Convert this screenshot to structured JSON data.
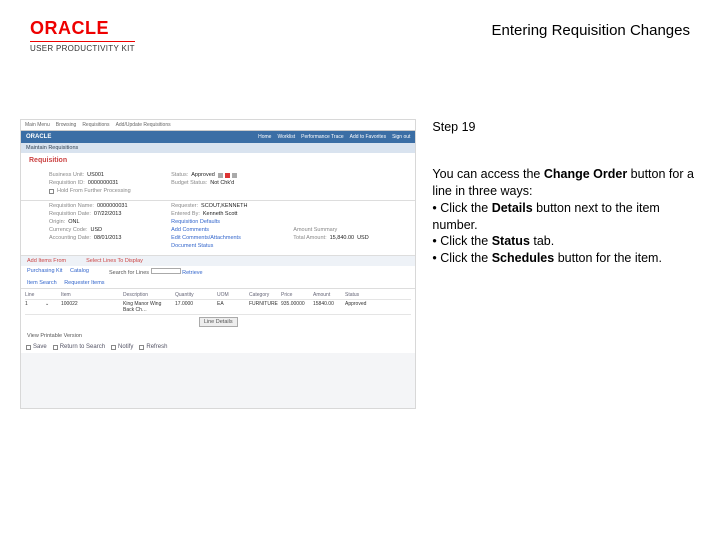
{
  "header": {
    "logo_text": "ORACLE",
    "logo_sub": "USER PRODUCTIVITY KIT",
    "page_title": "Entering Requisition Changes"
  },
  "screenshot": {
    "app_tabs": [
      "Main Menu",
      "Browsing",
      "Requisitions",
      "Add/Update Requisitions"
    ],
    "brand": "ORACLE",
    "brand_tabs": [
      "Home",
      "Worklist",
      "Performance Trace",
      "Add to Favorites",
      "Sign out"
    ],
    "breadcrumb": "Maintain Requisitions",
    "panel_title": "Requisition",
    "fields": {
      "bu": {
        "label": "Business Unit:",
        "value": "US001"
      },
      "req_id": {
        "label": "Requisition ID:",
        "value": "0000000031"
      },
      "status": {
        "label": "Status:",
        "value": "Approved"
      },
      "budget": {
        "label": "Budget Status:",
        "value": "Not Chk'd"
      },
      "hold": {
        "label": "Hold From Further Processing",
        "value": ""
      },
      "req_name": {
        "label": "Requisition Name:",
        "value": "0000000031"
      },
      "req_date": {
        "label": "Requisition Date:",
        "value": "07/22/2013"
      },
      "requester": {
        "label": "Requester:",
        "value": "SCOUT,KENNETH"
      },
      "origin": {
        "label": "Origin:",
        "value": "ONL"
      },
      "currency": {
        "label": "Currency Code:",
        "value": "USD"
      },
      "acct_date": {
        "label": "Accounting Date:",
        "value": "08/01/2013"
      },
      "entered": {
        "label": "Entered By:",
        "value": "Kenneth Scott"
      },
      "dflt": {
        "label": "Requisition Defaults",
        "value": ""
      },
      "cmt": {
        "label": "Add Comments",
        "value": ""
      },
      "attach": {
        "label": "Edit Comments/Attachments",
        "value": ""
      },
      "amt_sum": {
        "label": "Amount Summary",
        "value": ""
      },
      "total": {
        "label": "Total Amount:",
        "value": "15,840.00"
      },
      "total_ccy": {
        "value": "USD"
      },
      "doc_status": {
        "label": "Document Status",
        "value": ""
      }
    },
    "add_items": "Add Items From",
    "add_tabs": [
      "Purchasing Kit",
      "Catalog",
      "Item Search",
      "Requester Items"
    ],
    "select_lines": "Select Lines To Display",
    "line_search": {
      "label": "Search for Lines",
      "go": "Retrieve"
    },
    "grid": {
      "headers": [
        "Line",
        "",
        "Item",
        "Description",
        "Quantity",
        "UOM",
        "Category",
        "Price",
        "Amount",
        "Status"
      ],
      "row": [
        "1",
        "⌄",
        "100022",
        "King Manor Wing Back Ch…",
        "17.0000",
        "EA",
        "FURNITURE",
        "935.00000",
        "15840.00",
        "Approved"
      ]
    },
    "line_details": "Line Details",
    "view_printable": "View Printable Version",
    "foot_tabs": [
      "Save",
      "Return to Search",
      "Notify",
      "Refresh"
    ]
  },
  "instructions": {
    "step": "Step 19",
    "l1a": "You can access the ",
    "l1b": "Change Order",
    "l2": " button for a line in three ways:",
    "b1a": "• Click the ",
    "b1b": "Details",
    "b1c": " button next to the item number.",
    "b2a": "• Click the ",
    "b2b": "Status",
    "b2c": " tab.",
    "b3a": "• Click the ",
    "b3b": "Schedules",
    "b3c": " button for the item."
  }
}
